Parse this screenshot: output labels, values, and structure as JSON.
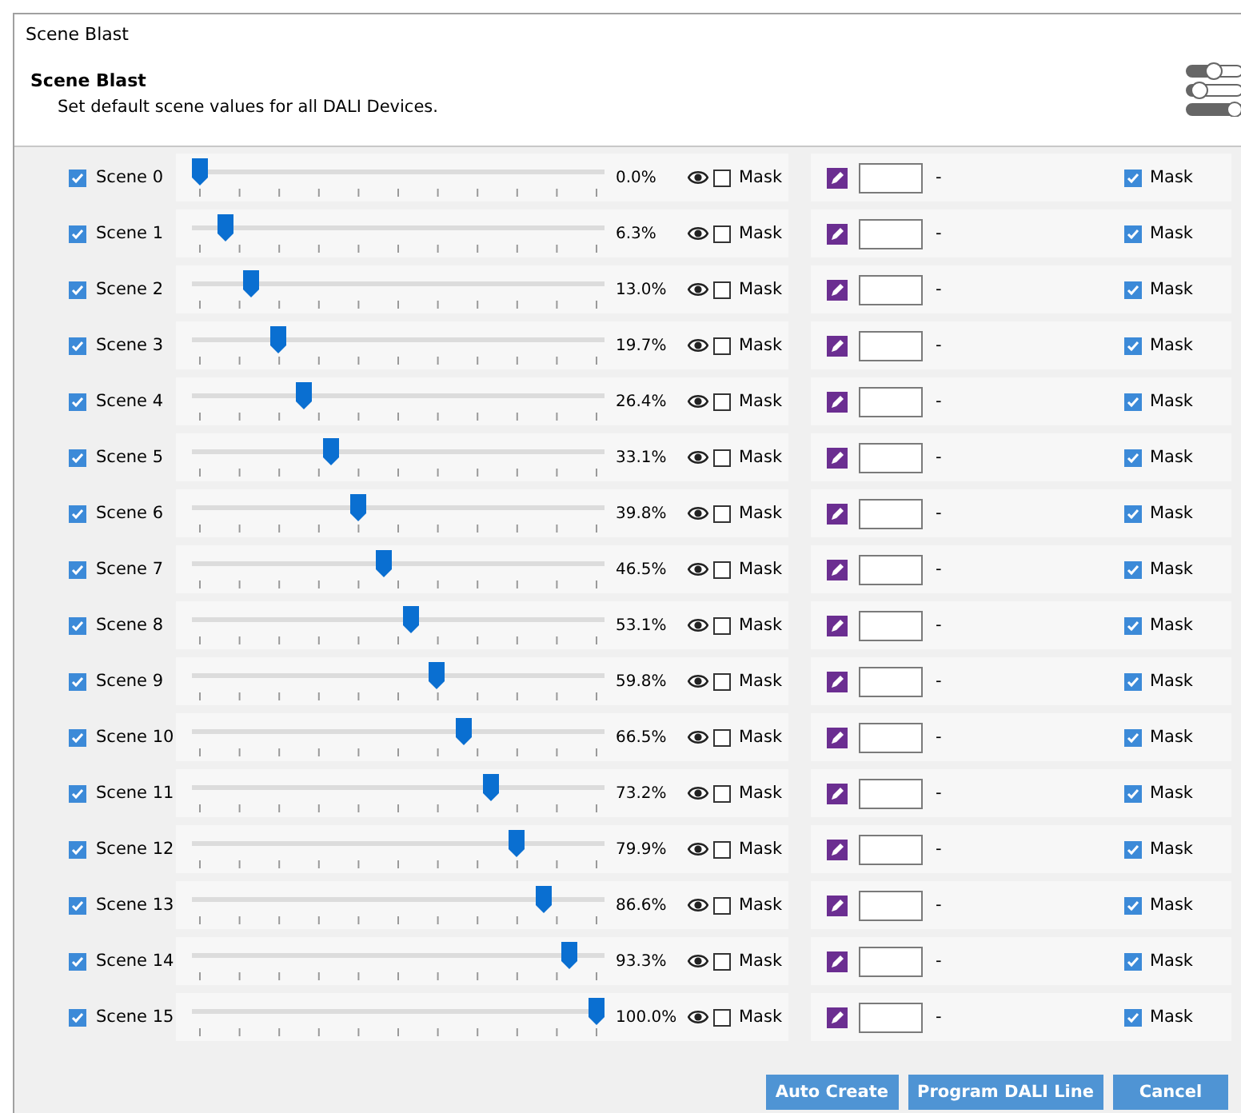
{
  "window": {
    "title": "Scene Blast"
  },
  "header": {
    "title": "Scene Blast",
    "subtitle": "Set default scene values for all DALI Devices."
  },
  "scenes": [
    {
      "label": "Scene 0",
      "checked": true,
      "level": 0.0,
      "reading": "0.0%",
      "mask_label": "Mask",
      "mask_checked": false,
      "dash": "-",
      "right_mask_label": "Mask",
      "right_mask_checked": true
    },
    {
      "label": "Scene 1",
      "checked": true,
      "level": 0.063,
      "reading": "6.3%",
      "mask_label": "Mask",
      "mask_checked": false,
      "dash": "-",
      "right_mask_label": "Mask",
      "right_mask_checked": true
    },
    {
      "label": "Scene 2",
      "checked": true,
      "level": 0.13,
      "reading": "13.0%",
      "mask_label": "Mask",
      "mask_checked": false,
      "dash": "-",
      "right_mask_label": "Mask",
      "right_mask_checked": true
    },
    {
      "label": "Scene 3",
      "checked": true,
      "level": 0.197,
      "reading": "19.7%",
      "mask_label": "Mask",
      "mask_checked": false,
      "dash": "-",
      "right_mask_label": "Mask",
      "right_mask_checked": true
    },
    {
      "label": "Scene 4",
      "checked": true,
      "level": 0.264,
      "reading": "26.4%",
      "mask_label": "Mask",
      "mask_checked": false,
      "dash": "-",
      "right_mask_label": "Mask",
      "right_mask_checked": true
    },
    {
      "label": "Scene 5",
      "checked": true,
      "level": 0.331,
      "reading": "33.1%",
      "mask_label": "Mask",
      "mask_checked": false,
      "dash": "-",
      "right_mask_label": "Mask",
      "right_mask_checked": true
    },
    {
      "label": "Scene 6",
      "checked": true,
      "level": 0.398,
      "reading": "39.8%",
      "mask_label": "Mask",
      "mask_checked": false,
      "dash": "-",
      "right_mask_label": "Mask",
      "right_mask_checked": true
    },
    {
      "label": "Scene 7",
      "checked": true,
      "level": 0.465,
      "reading": "46.5%",
      "mask_label": "Mask",
      "mask_checked": false,
      "dash": "-",
      "right_mask_label": "Mask",
      "right_mask_checked": true
    },
    {
      "label": "Scene 8",
      "checked": true,
      "level": 0.531,
      "reading": "53.1%",
      "mask_label": "Mask",
      "mask_checked": false,
      "dash": "-",
      "right_mask_label": "Mask",
      "right_mask_checked": true
    },
    {
      "label": "Scene 9",
      "checked": true,
      "level": 0.598,
      "reading": "59.8%",
      "mask_label": "Mask",
      "mask_checked": false,
      "dash": "-",
      "right_mask_label": "Mask",
      "right_mask_checked": true
    },
    {
      "label": "Scene 10",
      "checked": true,
      "level": 0.665,
      "reading": "66.5%",
      "mask_label": "Mask",
      "mask_checked": false,
      "dash": "-",
      "right_mask_label": "Mask",
      "right_mask_checked": true
    },
    {
      "label": "Scene 11",
      "checked": true,
      "level": 0.732,
      "reading": "73.2%",
      "mask_label": "Mask",
      "mask_checked": false,
      "dash": "-",
      "right_mask_label": "Mask",
      "right_mask_checked": true
    },
    {
      "label": "Scene 12",
      "checked": true,
      "level": 0.799,
      "reading": "79.9%",
      "mask_label": "Mask",
      "mask_checked": false,
      "dash": "-",
      "right_mask_label": "Mask",
      "right_mask_checked": true
    },
    {
      "label": "Scene 13",
      "checked": true,
      "level": 0.866,
      "reading": "86.6%",
      "mask_label": "Mask",
      "mask_checked": false,
      "dash": "-",
      "right_mask_label": "Mask",
      "right_mask_checked": true
    },
    {
      "label": "Scene 14",
      "checked": true,
      "level": 0.933,
      "reading": "93.3%",
      "mask_label": "Mask",
      "mask_checked": false,
      "dash": "-",
      "right_mask_label": "Mask",
      "right_mask_checked": true
    },
    {
      "label": "Scene 15",
      "checked": true,
      "level": 1.0,
      "reading": "100.0%",
      "mask_label": "Mask",
      "mask_checked": false,
      "dash": "-",
      "right_mask_label": "Mask",
      "right_mask_checked": true
    }
  ],
  "buttons": [
    "Auto Create",
    "Program DALI Line",
    "Cancel"
  ]
}
